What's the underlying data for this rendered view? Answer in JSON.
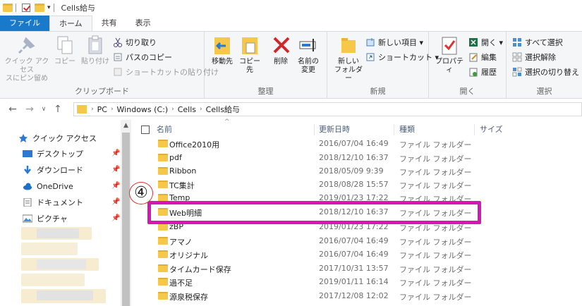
{
  "window": {
    "title": "Cells給与"
  },
  "tabs": [
    "ファイル",
    "ホーム",
    "共有",
    "表示"
  ],
  "ribbon": {
    "clipboard": {
      "label": "クリップボード",
      "pin_label_1": "クイック アクセス",
      "pin_label_2": "スにピン留め",
      "copy_label": "コピー",
      "paste_label": "貼り付け",
      "cut_label": "切り取り",
      "copy_path_label": "パスのコピー",
      "paste_shortcut_label": "ショートカットの貼り付け"
    },
    "organize": {
      "label": "整理",
      "move_label": "移動先",
      "copyto_label": "コピー先",
      "delete_label": "削除",
      "rename_label_1": "名前の",
      "rename_label_2": "変更"
    },
    "new": {
      "label": "新規",
      "new_folder_1": "新しい",
      "new_folder_2": "フォルダー",
      "new_item_label": "新しい項目 ▾",
      "shortcut_label": "ショートカット ▾"
    },
    "open": {
      "label": "開く",
      "properties_label": "プロパティ",
      "open_label": "開く ▾",
      "edit_label": "編集",
      "history_label": "履歴"
    },
    "select": {
      "label": "選択",
      "select_all_label": "すべて選択",
      "select_none_label": "選択解除",
      "invert_label": "選択の切り替え"
    }
  },
  "address": {
    "crumbs": [
      "PC",
      "Windows (C:)",
      "Cells",
      "Cells給与"
    ]
  },
  "navpane": {
    "items": [
      {
        "label": "クイック アクセス",
        "icon": "star-icon",
        "pinned": false
      },
      {
        "label": "デスクトップ",
        "icon": "desktop-icon",
        "pinned": true
      },
      {
        "label": "ダウンロード",
        "icon": "download-icon",
        "pinned": true
      },
      {
        "label": "OneDrive",
        "icon": "cloud-icon",
        "pinned": true
      },
      {
        "label": "ドキュメント",
        "icon": "document-icon",
        "pinned": true
      },
      {
        "label": "ピクチャ",
        "icon": "picture-icon",
        "pinned": true
      }
    ]
  },
  "filelist": {
    "columns": {
      "name": "名前",
      "date": "更新日時",
      "type": "種類",
      "size": "サイズ"
    },
    "rows": [
      {
        "name": "Office2010用",
        "date": "2016/07/04 16:49",
        "type": "ファイル フォルダー"
      },
      {
        "name": "pdf",
        "date": "2018/12/10 16:37",
        "type": "ファイル フォルダー"
      },
      {
        "name": "Ribbon",
        "date": "2018/05/09 9:39",
        "type": "ファイル フォルダー"
      },
      {
        "name": "TC集計",
        "date": "2018/08/28 15:57",
        "type": "ファイル フォルダー"
      },
      {
        "name": "Temp",
        "date": "2019/01/23 17:22",
        "type": "ファイル フォルダー"
      },
      {
        "name": "Web明細",
        "date": "2018/12/10 16:37",
        "type": "ファイル フォルダー"
      },
      {
        "name": "zBP",
        "date": "2019/01/23 17:22",
        "type": "ファイル フォルダー"
      },
      {
        "name": "アマノ",
        "date": "2016/07/04 16:49",
        "type": "ファイル フォルダー"
      },
      {
        "name": "オリジナル",
        "date": "2016/07/04 16:49",
        "type": "ファイル フォルダー"
      },
      {
        "name": "タイムカード保存",
        "date": "2017/10/31 13:57",
        "type": "ファイル フォルダー"
      },
      {
        "name": "過不足",
        "date": "2019/01/11 16:14",
        "type": "ファイル フォルダー"
      },
      {
        "name": "源泉税保存",
        "date": "2017/12/08 12:02",
        "type": "ファイル フォルダー"
      }
    ]
  },
  "annotation": {
    "step_number": "④",
    "highlight_color": "#d418b4"
  }
}
